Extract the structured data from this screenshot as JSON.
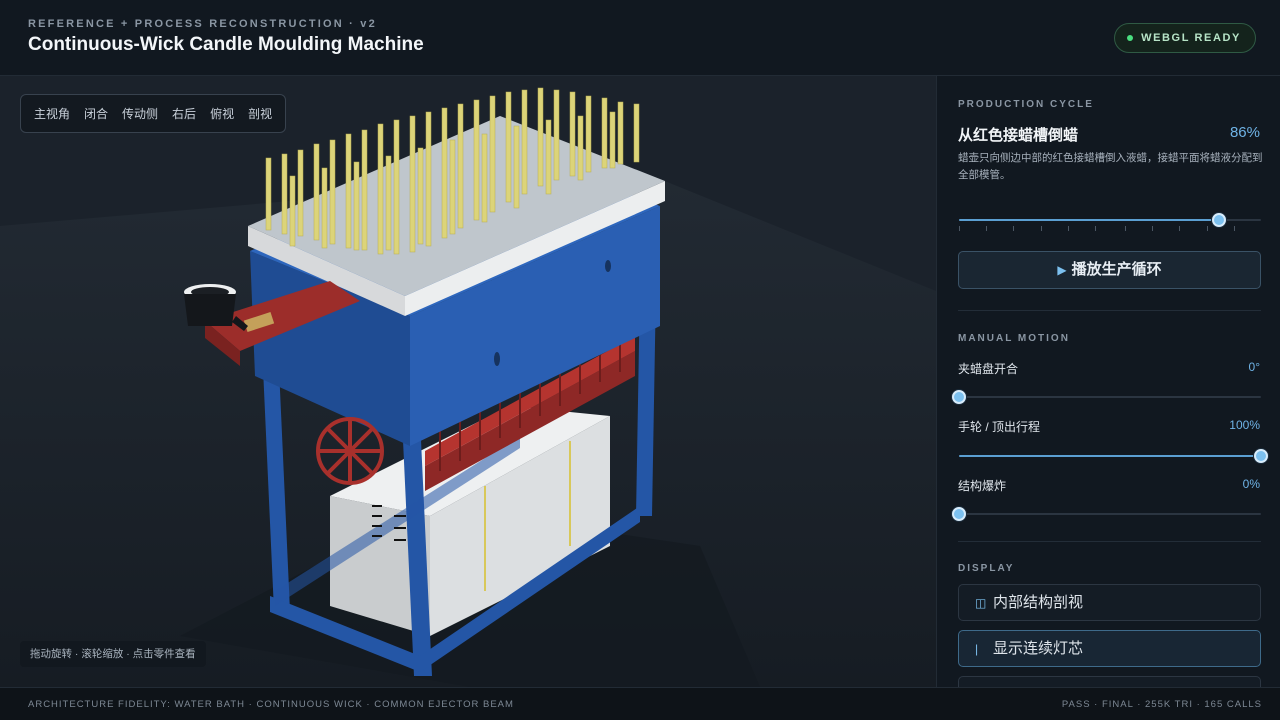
{
  "header": {
    "kicker": "REFERENCE + PROCESS RECONSTRUCTION · v2",
    "title": "Continuous-Wick Candle Moulding Machine",
    "status_badge": "WEBGL READY"
  },
  "viewport": {
    "view_buttons": [
      "主视角",
      "闭合",
      "传动侧",
      "右后",
      "俯视",
      "剖视"
    ],
    "hint": "拖动旋转 · 滚轮缩放 · 点击零件查看"
  },
  "panel": {
    "production": {
      "label": "PRODUCTION CYCLE",
      "stage_title": "从红色接蜡槽倒蜡",
      "stage_percent": "86%",
      "stage_desc": "蜡壶只向侧边中部的红色接蜡槽倒入液蜡，接蜡平面将蜡液分配到全部模管。",
      "progress": 0.86,
      "play_label": "播放生产循环",
      "play_icon": "play-icon"
    },
    "manual": {
      "label": "MANUAL MOTION",
      "controls": [
        {
          "name": "夹蜡盘开合",
          "value": "0°",
          "level": 0.0
        },
        {
          "name": "手轮 / 顶出行程",
          "value": "100%",
          "level": 1.0
        },
        {
          "name": "结构爆炸",
          "value": "0%",
          "level": 0.0
        }
      ]
    },
    "display": {
      "label": "DISPLAY",
      "buttons": [
        {
          "label": "内部结构剖视",
          "icon": "section-view-icon"
        },
        {
          "label": "显示连续灯芯",
          "icon": "wick-line-icon"
        }
      ]
    }
  },
  "footer": {
    "left": "ARCHITECTURE FIDELITY: WATER BATH · CONTINUOUS WICK · COMMON EJECTOR BEAM",
    "right": "PASS · FINAL · 255K TRI · 165 CALLS"
  },
  "colors": {
    "frame_blue": "#2456a6",
    "red_trough": "#a8302c",
    "candle_yellow": "#dcd479",
    "accent": "#6fb3e6",
    "ready_green": "#4ade80"
  }
}
